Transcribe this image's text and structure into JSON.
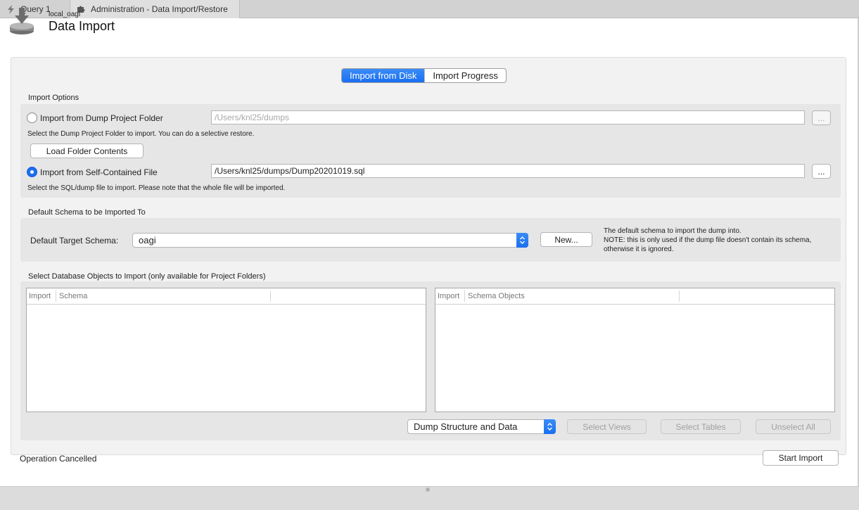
{
  "tabs": [
    {
      "label": "Query 1",
      "icon": "lightning-icon"
    },
    {
      "label": "Administration - Data Import/Restore",
      "icon": "puzzle-icon"
    }
  ],
  "header": {
    "connection": "local_oagi",
    "title": "Data Import"
  },
  "segments": {
    "from_disk": "Import from Disk",
    "progress": "Import Progress"
  },
  "import_options": {
    "label": "Import Options",
    "dump_folder": {
      "label": "Import from Dump Project Folder",
      "path": "/Users/knl25/dumps",
      "hint": "Select the Dump Project Folder to import. You can do a selective restore.",
      "browse": "...",
      "load_button": "Load Folder Contents"
    },
    "self_contained": {
      "label": "Import from Self-Contained File",
      "path": "/Users/knl25/dumps/Dump20201019.sql",
      "hint": "Select the SQL/dump file to import. Please note that the whole file will be imported.",
      "browse": "..."
    }
  },
  "default_schema": {
    "label": "Default Schema to be Imported To",
    "target_label": "Default Target Schema:",
    "target_value": "oagi",
    "new_button": "New...",
    "note_line1": "The default schema to import the dump into.",
    "note_line2": "NOTE: this is only used if the dump file doesn't contain its schema,",
    "note_line3": "otherwise it is ignored."
  },
  "objects": {
    "label": "Select Database Objects to Import (only available for Project Folders)",
    "left_table": {
      "col1": "Import",
      "col2": "Schema"
    },
    "right_table": {
      "col1": "Import",
      "col2": "Schema Objects"
    },
    "dump_mode": "Dump Structure and Data",
    "select_views": "Select Views",
    "select_tables": "Select Tables",
    "unselect_all": "Unselect All"
  },
  "status": "Operation Cancelled",
  "start_import": "Start Import",
  "colors": {
    "accent": "#1a6ff1",
    "panel": "#f2f2f2",
    "group": "#e6e6e6"
  }
}
